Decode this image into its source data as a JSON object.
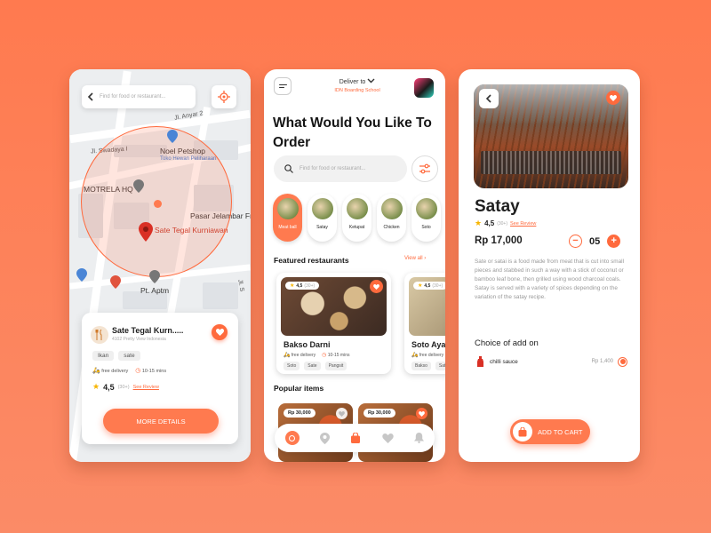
{
  "colors": {
    "accent": "#ff7a4f",
    "star": "#f7b500",
    "map_circle": "#ff6a3d"
  },
  "map_screen": {
    "search_placeholder": "Find for food or restaurant...",
    "labels": {
      "street1": "Jl. Anyar 2",
      "street2": "Jl. Swadaya I",
      "petshop_name": "Noel Petshop",
      "petshop_sub": "Toko Hewan Peliharaan",
      "hq": "MOTRELA HQ",
      "market": "Pasar Jelambar Fr",
      "restaurant": "Sate Tegal Kurniawan",
      "company": "Pt. Aptm",
      "street3": "Jl. S"
    },
    "card": {
      "name": "Sate Tegal Kurn.....",
      "address": "4102 Pretty View Indonesia",
      "tags": [
        "Ikan",
        "sate"
      ],
      "delivery": "free delivery",
      "time": "10-15 mins",
      "rating": "4,5",
      "rating_count": "(30+)",
      "review_link": "See Review",
      "button": "MORE DETAILS"
    }
  },
  "home_screen": {
    "deliver_to": "Deliver to",
    "location": "IDN Boarding School",
    "headline": "What Would You Like To Order",
    "search_placeholder": "Find for food or restaurant...",
    "categories": [
      {
        "label": "Meat ball",
        "active": true
      },
      {
        "label": "Satay",
        "active": false
      },
      {
        "label": "Ketupat",
        "active": false
      },
      {
        "label": "Chicken",
        "active": false
      },
      {
        "label": "Soto",
        "active": false
      }
    ],
    "featured_title": "Featured restaurants",
    "view_all": "View all ›",
    "restaurants": [
      {
        "name": "Bakso Darni",
        "rating": "4,5",
        "count": "(30+)",
        "delivery": "free delivery",
        "time": "10-15 mins",
        "tags": [
          "Soto",
          "Sate",
          "Pangsit"
        ]
      },
      {
        "name": "Soto Ayam",
        "rating": "4,5",
        "count": "(30+)",
        "delivery": "free delivery",
        "time": "",
        "tags": [
          "Bakso",
          "Sate"
        ]
      }
    ],
    "popular_title": "Popular items",
    "popular": [
      {
        "price": "Rp 30,000"
      },
      {
        "price": "Rp 30,000"
      }
    ]
  },
  "detail_screen": {
    "title": "Satay",
    "rating": "4,5",
    "rating_count": "(30+)",
    "review_link": "See Review",
    "price": "Rp 17,000",
    "quantity": "05",
    "description": "Sate or satai is a food made from meat that is cut into small pieces and stabbed in such a way with a stick of coconut or bamboo leaf bone, then grilled using wood charcoal coals. Satay is served with a variety of spices depending on the variation of the satay recipe.",
    "addon_title": "Choice of add on",
    "addons": [
      {
        "name": "chilli sauce",
        "price": "Rp 1,400"
      }
    ],
    "cart_button": "ADD TO CART"
  }
}
